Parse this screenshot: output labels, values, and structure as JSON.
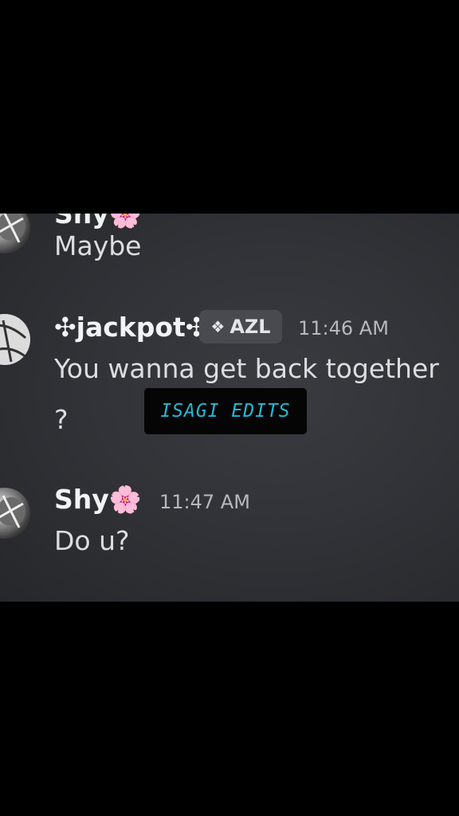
{
  "messages": [
    {
      "username": "Shy",
      "text": "Maybe"
    },
    {
      "username": "✣jackpot✣",
      "tag": "AZL",
      "tag_icon": "diamond-cluster-icon",
      "time": "11:46 AM",
      "text_line1": "You wanna get back together",
      "text_line2": "?"
    },
    {
      "username": "Shy",
      "time": "11:47 AM",
      "text": "Do u?"
    }
  ],
  "emoji": "🌸",
  "watermark": "ISAGI EDITS",
  "colors": {
    "background": "#323338",
    "watermark_text": "#22b9d6",
    "username": "#f2f3f5",
    "message_text": "#dcdde1"
  }
}
